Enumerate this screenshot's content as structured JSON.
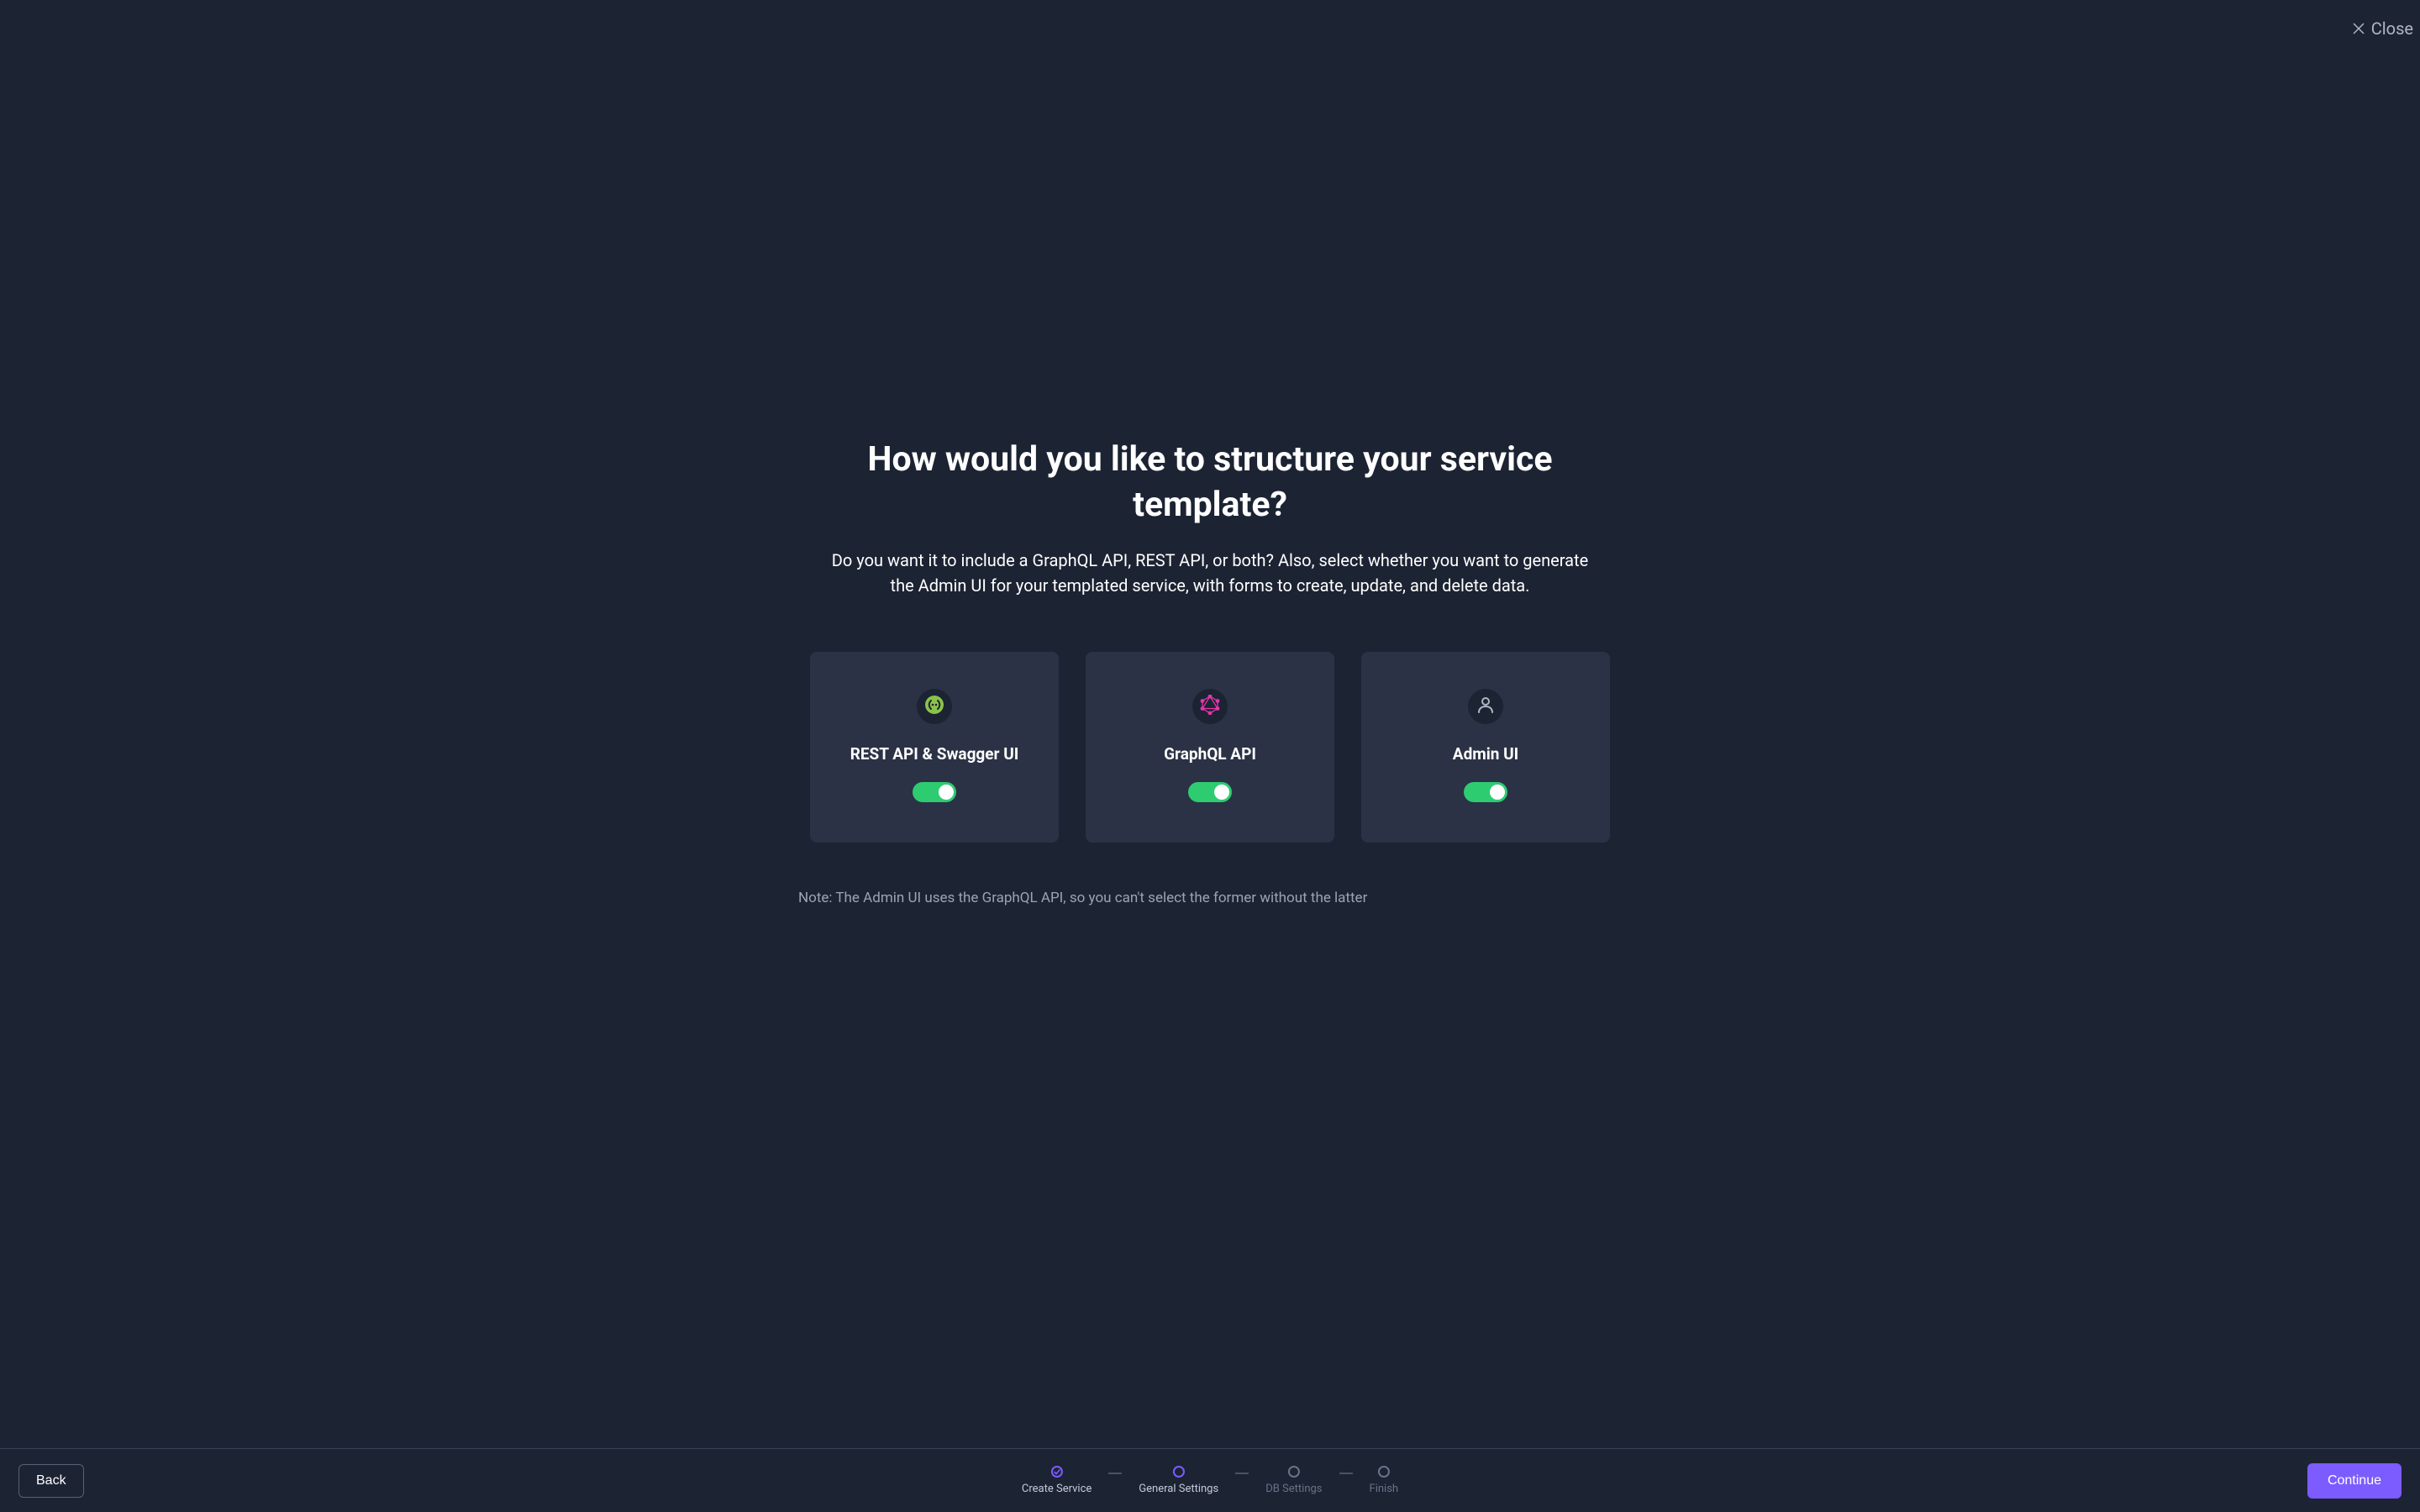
{
  "close": {
    "label": "Close"
  },
  "heading": "How would you like to structure your service template?",
  "description": "Do you want it to include a GraphQL API, REST API, or both? Also, select whether you want to generate the Admin UI for your templated service, with forms to create, update, and delete data.",
  "options": {
    "rest": {
      "title": "REST API & Swagger UI",
      "enabled": true,
      "icon_color": "#8BC34A"
    },
    "graphql": {
      "title": "GraphQL API",
      "enabled": true,
      "icon_color": "#E535AB"
    },
    "admin": {
      "title": "Admin UI",
      "enabled": true,
      "icon_color": "#b0b6c2"
    }
  },
  "note": "Note: The Admin UI uses the GraphQL API, so you can't select the former without the latter",
  "footer": {
    "back_label": "Back",
    "continue_label": "Continue",
    "steps": [
      {
        "label": "Create Service",
        "state": "completed"
      },
      {
        "label": "General Settings",
        "state": "active"
      },
      {
        "label": "DB Settings",
        "state": "inactive"
      },
      {
        "label": "Finish",
        "state": "inactive"
      }
    ]
  }
}
